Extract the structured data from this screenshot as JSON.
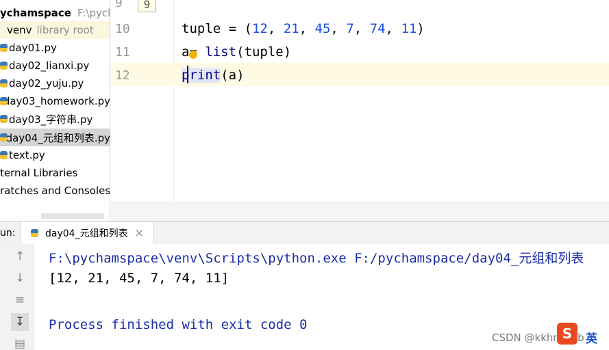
{
  "project": {
    "root": {
      "name": "ychamspace",
      "path": "F:\\pychar"
    },
    "venv": {
      "name": "venv",
      "note": "library root"
    },
    "files": [
      "day01.py",
      "day02_lianxi.py",
      "day02_yuju.py",
      "day03_homework.py",
      "day03_字符串.py",
      "day04_元组和列表.py",
      "text.py"
    ],
    "selected_index": 5,
    "external": "ternal Libraries",
    "scratches": "ratches and Consoles"
  },
  "editor": {
    "fold_marker": "9",
    "line_numbers": [
      "9",
      "10",
      "11",
      "12"
    ],
    "line10": {
      "var": "tuple",
      "op": " = (",
      "nums": [
        "12",
        "21",
        "45",
        "7",
        "74",
        "11"
      ],
      "close": ")"
    },
    "line11": {
      "a": "a",
      "rest": "= ",
      "func": "list",
      "args": "(tuple)"
    },
    "line12": {
      "func": "print",
      "args": "(a)"
    }
  },
  "run": {
    "label": "un:",
    "tab_label": "day04_元组和列表",
    "close_icon": "×"
  },
  "console": {
    "command": "F:\\pychamspace\\venv\\Scripts\\python.exe F:/pychamspace/day04_元组和列表",
    "output": "[12, 21, 45, 7, 74, 11]",
    "exit": "Process finished with exit code 0"
  },
  "toolbar_icons": [
    "up-arrow-icon",
    "down-arrow-icon",
    "soft-wrap-icon",
    "scroll-to-end-icon",
    "print-icon"
  ],
  "watermark": {
    "csdn": "CSDN @kkhnseob",
    "sogou": "S",
    "lang": "英"
  },
  "colors": {
    "number": "#1750eb",
    "builtin": "#000080",
    "console_blue": "#1a2ea8",
    "selection": "#d5d5d5"
  }
}
